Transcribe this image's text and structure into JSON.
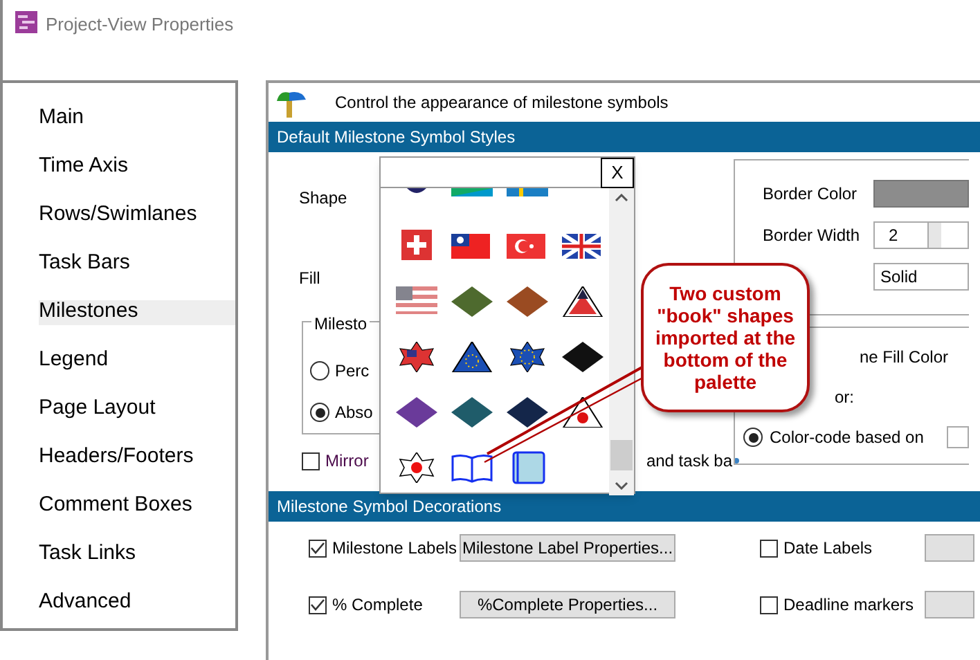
{
  "window": {
    "title": "Project-View Properties"
  },
  "sidebar": {
    "items": [
      {
        "label": "Main",
        "selected": false
      },
      {
        "label": "Time Axis",
        "selected": false
      },
      {
        "label": "Rows/Swimlanes",
        "selected": false
      },
      {
        "label": "Task Bars",
        "selected": false
      },
      {
        "label": "Milestones",
        "selected": true
      },
      {
        "label": "Legend",
        "selected": false
      },
      {
        "label": "Page Layout",
        "selected": false
      },
      {
        "label": "Headers/Footers",
        "selected": false
      },
      {
        "label": "Comment Boxes",
        "selected": false
      },
      {
        "label": "Task Links",
        "selected": false
      },
      {
        "label": "Advanced",
        "selected": false
      }
    ]
  },
  "header": {
    "text": "Control the appearance of milestone symbols"
  },
  "styles_section": {
    "title": "Default Milestone Symbol Styles",
    "shape_label": "Shape",
    "fill_label": "Fill",
    "group": {
      "title": "Milesto",
      "options": [
        {
          "label": "Perc",
          "selected": false
        },
        {
          "label": "Abso",
          "selected": true
        }
      ]
    },
    "mirror": {
      "label": "Mirror",
      "checked": false
    },
    "trailing_text": "and task ba",
    "border_color_label": "Border Color",
    "border_width_label": "Border Width",
    "border_width_value": "2",
    "line_style": "Solid",
    "fill_color_label": "ne Fill Color",
    "color_label": "or:",
    "color_code": {
      "label": "Color-code based on",
      "selected": true
    }
  },
  "palette": {
    "close": "X"
  },
  "callout": {
    "text": "Two custom \"book\" shapes imported at the bottom of the palette"
  },
  "decorations_section": {
    "title": "Milestone Symbol Decorations",
    "options": [
      {
        "label": "Milestone Labels",
        "checked": true,
        "button": "Milestone Label Properties..."
      },
      {
        "label": "Date Labels",
        "checked": false
      },
      {
        "label": "% Complete",
        "checked": true,
        "button": "%Complete Properties..."
      },
      {
        "label": "Deadline markers",
        "checked": false
      }
    ]
  }
}
